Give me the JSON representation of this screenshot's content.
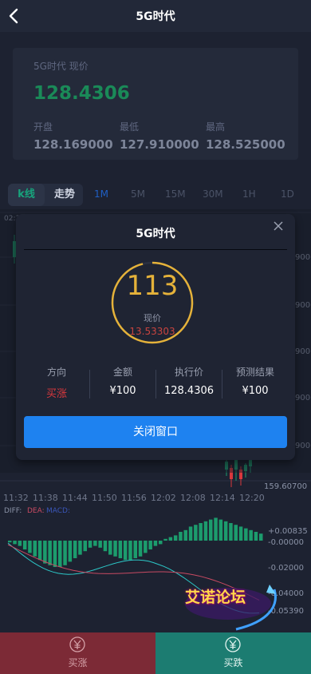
{
  "header": {
    "title": "5G时代"
  },
  "price_card": {
    "label": "5G时代 现价",
    "price": "128.4306",
    "stats": [
      {
        "label": "开盘",
        "value": "128.169000"
      },
      {
        "label": "最低",
        "value": "127.910000"
      },
      {
        "label": "最高",
        "value": "128.525000"
      }
    ]
  },
  "tabs": {
    "mode_active": "k线",
    "mode_inactive": "走势",
    "timeframes": [
      "1M",
      "5M",
      "15M",
      "30M",
      "1H",
      "1D"
    ],
    "active_timeframe": "1M"
  },
  "chart": {
    "time_label": "02:3",
    "right_axis": [
      "900",
      "900",
      "900",
      "900",
      "900",
      "900"
    ],
    "last_price": "159.60700",
    "x_ticks": [
      "11:32",
      "11:38",
      "11:44",
      "11:50",
      "11:56",
      "12:02",
      "12:08",
      "12:14",
      "12:20"
    ],
    "macd_legend": {
      "diff": "DIFF:",
      "dea": "DEA:",
      "macd": "MACD:"
    },
    "macd_axis": [
      "+0.00835",
      "-0.00000",
      "-0.02000",
      "-0.04000",
      "-0.05390"
    ],
    "colors": {
      "up": "#d9383d",
      "down": "#1c9c6d",
      "diff_line": "#2cc8c8",
      "dea_line": "#c84a62"
    }
  },
  "modal": {
    "title": "5G时代",
    "countdown": "113",
    "countdown_progress": 0.96,
    "current_label": "现价",
    "current_value": "13.53303",
    "columns": [
      {
        "label": "方向",
        "value": "买涨"
      },
      {
        "label": "金额",
        "value": "¥100"
      },
      {
        "label": "执行价",
        "value": "128.4306"
      },
      {
        "label": "预测结果",
        "value": "¥100"
      }
    ],
    "close_label": "关闭窗口"
  },
  "bottom": {
    "buy_up": "买涨",
    "buy_down": "买跌"
  },
  "watermark": "艾诺论坛"
}
